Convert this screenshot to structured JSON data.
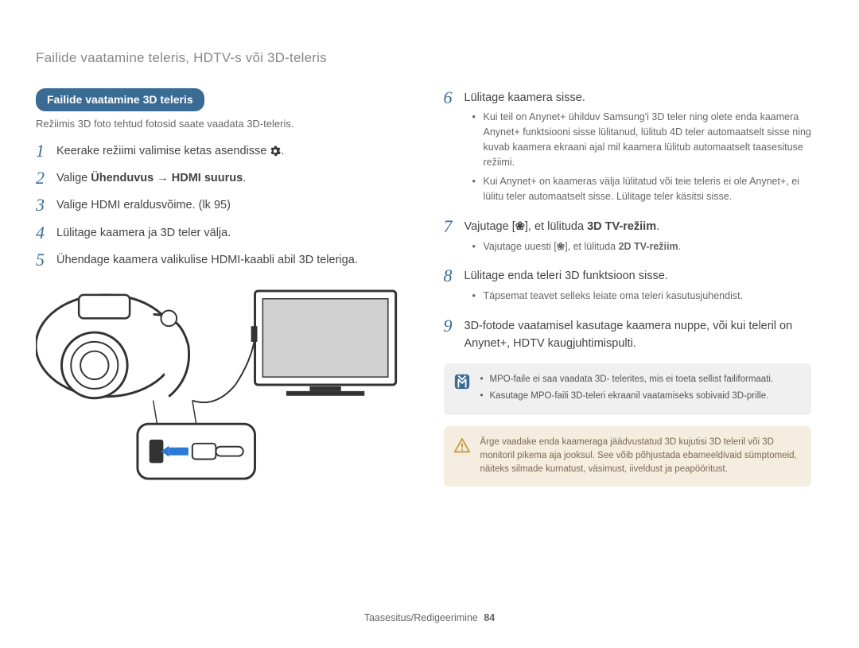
{
  "header": "Failide vaatamine teleris, HDTV-s või 3D-teleris",
  "pill": "Failide vaatamine 3D teleris",
  "intro": "Režiimis 3D foto tehtud fotosid saate vaadata 3D-teleris.",
  "left_steps": [
    {
      "n": "1",
      "text_a": "Keerake režiimi valimise ketas asendisse ",
      "text_b": ".",
      "has_gear": true
    },
    {
      "n": "2",
      "text_a": "Valige ",
      "bold": "Ühenduvus → HDMI suurus",
      "text_b": "."
    },
    {
      "n": "3",
      "text_a": "Valige HDMI eraldusvõime. (lk 95)"
    },
    {
      "n": "4",
      "text_a": "Lülitage kaamera ja 3D teler välja."
    },
    {
      "n": "5",
      "text_a": "Ühendage kaamera valikulise HDMI-kaabli abil 3D teleriga."
    }
  ],
  "right_steps": [
    {
      "n": "6",
      "text_a": "Lülitage kaamera sisse.",
      "sub": [
        "Kui teil on Anynet+ ühilduv Samsung'i 3D teler ning olete enda kaamera Anynet+ funktsiooni sisse lülitanud, lülitub 4D teler automaatselt sisse ning kuvab kaamera ekraani ajal mil kaamera lülitub automaatselt taasesituse režiimi.",
        "Kui Anynet+ on kaameras välja lülitatud või teie teleris ei ole Anynet+, ei lülitu teler automaatselt sisse. Lülitage teler käsitsi sisse."
      ]
    },
    {
      "n": "7",
      "text_a": "Vajutage [",
      "flower_a": true,
      "text_b": "], et lülituda ",
      "bold": "3D TV-režiim",
      "text_c": ".",
      "sub_rich": {
        "pre": "Vajutage uuesti [",
        "flower": true,
        "mid": "], et lülituda ",
        "bold": "2D TV-režiim",
        "post": "."
      }
    },
    {
      "n": "8",
      "text_a": "Lülitage enda teleri 3D funktsioon sisse.",
      "sub": [
        "Täpsemat teavet selleks leiate oma teleri kasutusjuhendist."
      ]
    },
    {
      "n": "9",
      "text_a": "3D-fotode vaatamisel kasutage kaamera nuppe, või kui teleril on Anynet+, HDTV kaugjuhtimispulti."
    }
  ],
  "note_items": [
    "MPO-faile ei saa vaadata 3D- telerites, mis ei toeta sellist failiformaati.",
    "Kasutage MPO-faili 3D-teleri ekraanil vaatamiseks sobivaid 3D-prille."
  ],
  "warning_text": "Ärge vaadake enda kaameraga jäädvustatud 3D kujutisi 3D teleril või 3D monitoril pikema aja jooksul. See võib põhjustada ebameeldivaid sümptomeid, näiteks silmade kurnatust, väsimust, iiveldust ja peapööritust.",
  "footer_label": "Taasesitus/Redigeerimine",
  "page_number": "84"
}
